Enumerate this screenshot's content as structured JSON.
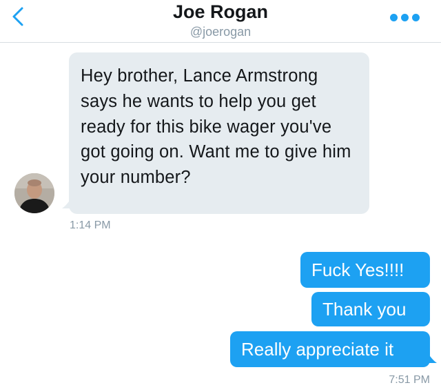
{
  "header": {
    "name": "Joe Rogan",
    "handle": "@joerogan",
    "back_icon": "chevron-left-icon",
    "more_icon": "more-horizontal-icon",
    "accent_color": "#1da1f2"
  },
  "messages": {
    "received": {
      "text": "Hey brother, Lance Armstrong says he wants to help you get ready for this bike wager you've got going on. Want me to give him your number?",
      "timestamp": "1:14 PM",
      "bubble_color": "#e6ecf0"
    },
    "sent": [
      {
        "text": "Fuck Yes!!!!"
      },
      {
        "text": "Thank you"
      },
      {
        "text": "Really appreciate it"
      }
    ],
    "sent_timestamp": "7:51 PM",
    "sent_bubble_color": "#1da1f2"
  }
}
